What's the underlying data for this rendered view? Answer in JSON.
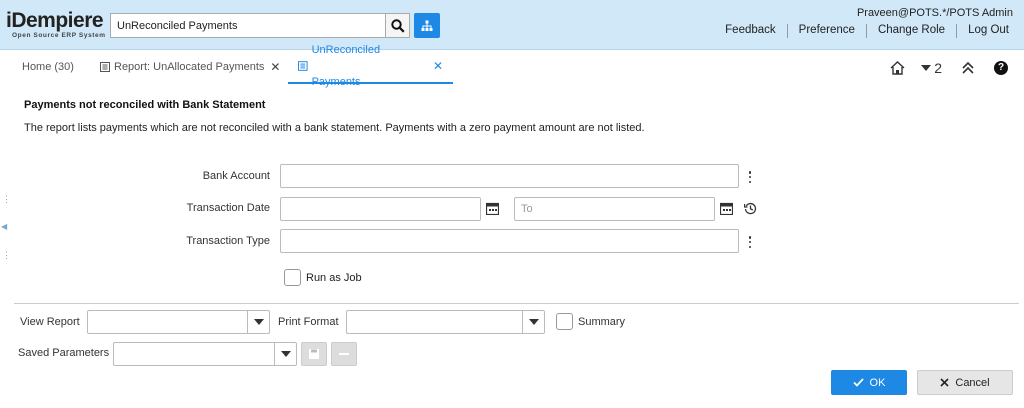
{
  "header": {
    "logo_main": "iDempiere",
    "logo_sub": "Open Source ERP System",
    "search_value": "UnReconciled Payments",
    "user": "Praveen@POTS.*/POTS Admin",
    "links": [
      "Feedback",
      "Preference",
      "Change Role",
      "Log Out"
    ]
  },
  "tabs": [
    {
      "label": "Home (30)",
      "closable": false,
      "active": false
    },
    {
      "label": "Report: UnAllocated Payments",
      "closable": true,
      "active": false
    },
    {
      "label": "UnReconciled Payments",
      "closable": true,
      "active": true
    }
  ],
  "tab_tools": {
    "window_count": "2"
  },
  "process": {
    "title": "Payments not reconciled with Bank Statement",
    "description": "The report lists payments which are not reconciled with a bank statement. Payments with a zero payment amount are not listed."
  },
  "fields": {
    "bank_account": {
      "label": "Bank Account",
      "value": ""
    },
    "transaction_date": {
      "label": "Transaction Date",
      "from": "",
      "to_placeholder": "To"
    },
    "transaction_type": {
      "label": "Transaction Type",
      "value": ""
    },
    "run_as_job": {
      "label": "Run as Job",
      "checked": false
    }
  },
  "report_options": {
    "view_report_label": "View Report",
    "print_format_label": "Print Format",
    "summary_label": "Summary",
    "saved_parameters_label": "Saved Parameters"
  },
  "buttons": {
    "ok": "OK",
    "cancel": "Cancel"
  },
  "colors": {
    "accent": "#1e88e5",
    "header_bg": "#d0e8f8"
  }
}
